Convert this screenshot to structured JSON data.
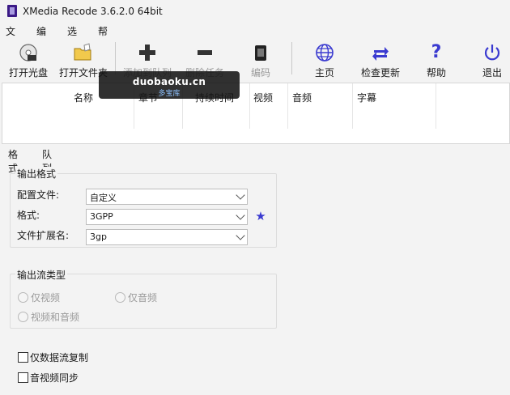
{
  "window": {
    "title": "XMedia Recode 3.6.2.0 64bit"
  },
  "menu": [
    "文件",
    "编辑",
    "选项",
    "帮助"
  ],
  "toolbar": {
    "open_disc": "打开光盘",
    "open_file": "打开文件夹",
    "add_queue": "添加到队列",
    "remove_task": "删除任务",
    "encode": "编码",
    "home": "主页",
    "check_update": "检查更新",
    "help": "帮助",
    "exit": "退出"
  },
  "filelist": {
    "columns": [
      "名称",
      "章节",
      "持续时间",
      "视频",
      "音频",
      "字幕"
    ]
  },
  "watermark": {
    "line1": "duobaoku.cn",
    "line2": "多宝库"
  },
  "tabs": [
    "格式",
    "队列"
  ],
  "output_format": {
    "group_title": "输出格式",
    "profile_label": "配置文件:",
    "profile_value": "自定义",
    "format_label": "格式:",
    "format_value": "3GPP",
    "ext_label": "文件扩展名:",
    "ext_value": "3gp"
  },
  "stream_type": {
    "group_title": "输出流类型",
    "video_only": "仅视频",
    "audio_only": "仅音频",
    "video_audio": "视频和音频"
  },
  "options": {
    "stream_copy": "仅数据流复制",
    "av_sync": "音视频同步"
  },
  "colors": {
    "accent": "#3a3ad0",
    "disabled_text": "#9a9a9a"
  }
}
